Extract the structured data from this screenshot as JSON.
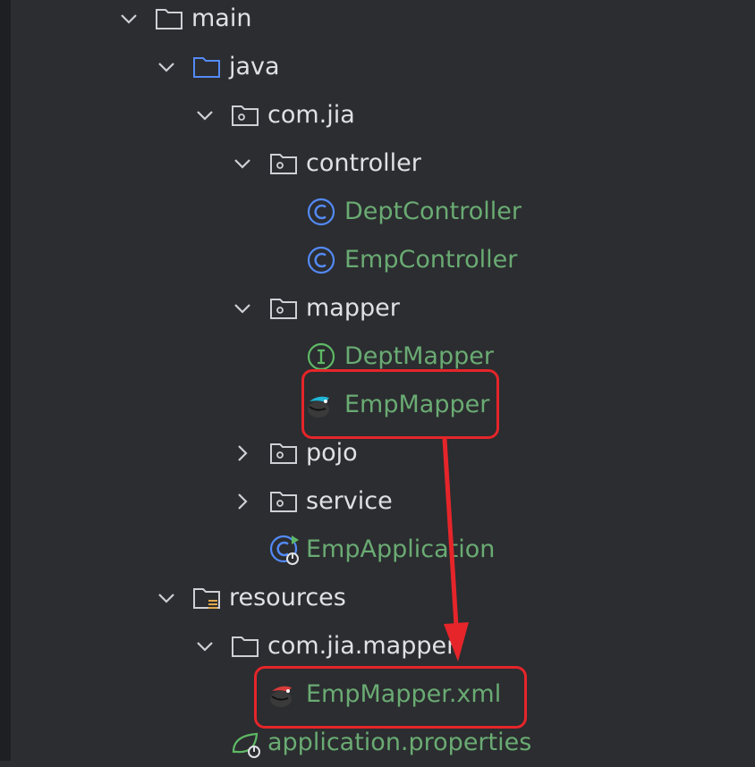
{
  "project_tree": {
    "items": [
      {
        "label": "main",
        "kind": "folder",
        "expanded": true
      },
      {
        "label": "java",
        "kind": "source-folder",
        "expanded": true
      },
      {
        "label": "com.jia",
        "kind": "package",
        "expanded": true
      },
      {
        "label": "controller",
        "kind": "package",
        "expanded": true
      },
      {
        "label": "DeptController",
        "kind": "class"
      },
      {
        "label": "EmpController",
        "kind": "class"
      },
      {
        "label": "mapper",
        "kind": "package",
        "expanded": true
      },
      {
        "label": "DeptMapper",
        "kind": "interface"
      },
      {
        "label": "EmpMapper",
        "kind": "mybatis-mapper"
      },
      {
        "label": "pojo",
        "kind": "package",
        "expanded": false
      },
      {
        "label": "service",
        "kind": "package",
        "expanded": false
      },
      {
        "label": "EmpApplication",
        "kind": "spring-boot-app"
      },
      {
        "label": "resources",
        "kind": "resources-folder",
        "expanded": true
      },
      {
        "label": "com.jia.mapper",
        "kind": "folder",
        "expanded": true
      },
      {
        "label": "EmpMapper.xml",
        "kind": "mybatis-xml"
      },
      {
        "label": "application.properties",
        "kind": "spring-properties"
      }
    ]
  },
  "colors": {
    "background": "#2b2d30",
    "folder_text": "#dfe1e5",
    "vcs_added_text": "#6aab73",
    "highlight": "#e5252a",
    "source_folder_icon": "#548af7"
  },
  "annotation": {
    "highlighted_items": [
      "EmpMapper",
      "EmpMapper.xml"
    ],
    "arrow": "EmpMapper → EmpMapper.xml"
  }
}
